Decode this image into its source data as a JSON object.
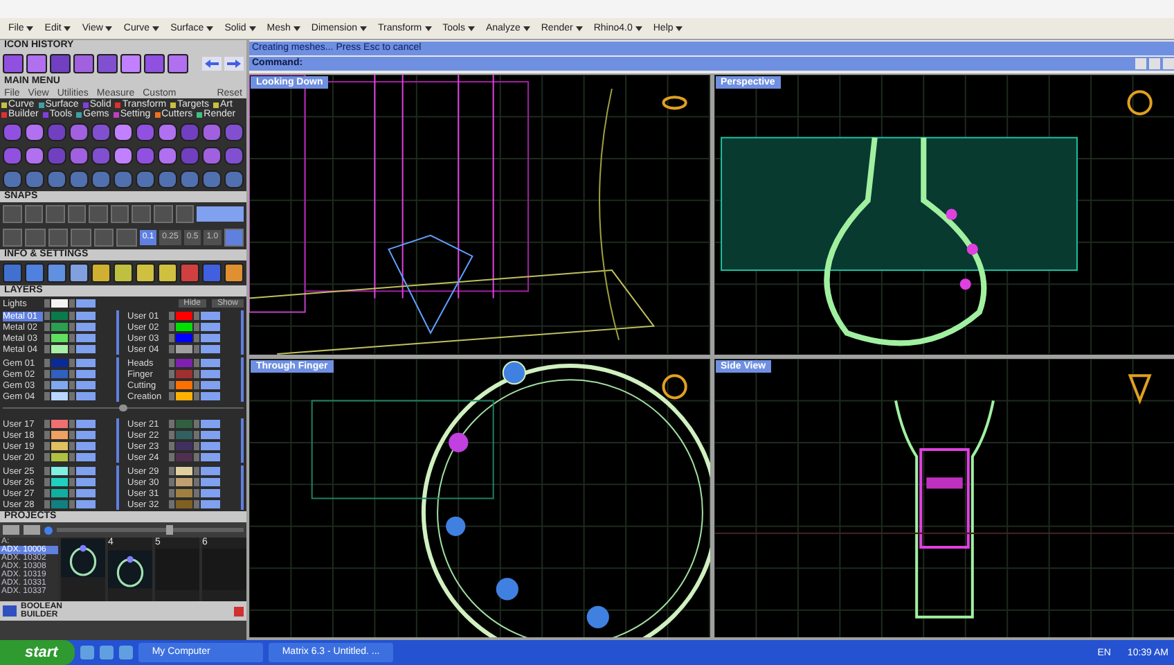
{
  "menu_bar": [
    "File",
    "Edit",
    "View",
    "Curve",
    "Surface",
    "Solid",
    "Mesh",
    "Dimension",
    "Transform",
    "Tools",
    "Analyze",
    "Render",
    "Rhino4.0",
    "Help"
  ],
  "icon_history": {
    "title": "ICON HISTORY"
  },
  "main_menu": {
    "title": "MAIN MENU",
    "menu": [
      "File",
      "View",
      "Utilities",
      "Measure",
      "Custom"
    ],
    "reset": "Reset",
    "categories": [
      {
        "label": "Curve",
        "color": "#c8c040"
      },
      {
        "label": "Surface",
        "color": "#40a0a0"
      },
      {
        "label": "Solid",
        "color": "#8040e0"
      },
      {
        "label": "Transform",
        "color": "#e03030"
      },
      {
        "label": "Targets",
        "color": "#c8c040"
      },
      {
        "label": "Art",
        "color": "#c8c040"
      },
      {
        "label": "Builder",
        "color": "#e03030"
      },
      {
        "label": "Tools",
        "color": "#8040e0"
      },
      {
        "label": "Gems",
        "color": "#40a0a0"
      },
      {
        "label": "Setting",
        "color": "#c040c0"
      },
      {
        "label": "Cutters",
        "color": "#f07020"
      },
      {
        "label": "Render",
        "color": "#40c080"
      }
    ]
  },
  "snaps": {
    "title": "SNAPS",
    "values": [
      {
        "label": "0.1",
        "selected": true
      },
      {
        "label": "0.25",
        "selected": false
      },
      {
        "label": "0.5",
        "selected": false
      },
      {
        "label": "1.0",
        "selected": false
      }
    ]
  },
  "info_settings": {
    "title": "INFO & SETTINGS"
  },
  "layers": {
    "title": "LAYERS",
    "lights": {
      "name": "Lights",
      "color": "#f4f4f4"
    },
    "hide": "Hide",
    "show": "Show",
    "sections": [
      {
        "left": [
          [
            {
              "name": "Metal 01",
              "color": "#0a7a4a",
              "selected": true
            },
            {
              "name": "Metal 02",
              "color": "#2aa050",
              "selected": false
            },
            {
              "name": "Metal 03",
              "color": "#60e060",
              "selected": false
            },
            {
              "name": "Metal 04",
              "color": "#a8f0a8",
              "selected": false
            }
          ],
          [
            {
              "name": "Gem 01",
              "color": "#0a2a9a",
              "selected": false
            },
            {
              "name": "Gem 02",
              "color": "#3060c0",
              "selected": false
            },
            {
              "name": "Gem 03",
              "color": "#80a8f0",
              "selected": false
            },
            {
              "name": "Gem 04",
              "color": "#b8d8ff",
              "selected": false
            }
          ]
        ],
        "right": [
          [
            {
              "name": "User 01",
              "color": "#ff0000",
              "selected": false
            },
            {
              "name": "User 02",
              "color": "#00e000",
              "selected": false
            },
            {
              "name": "User 03",
              "color": "#0000ff",
              "selected": false
            },
            {
              "name": "User 04",
              "color": "#a0a0a0",
              "selected": false
            }
          ],
          [
            {
              "name": "Heads",
              "color": "#8020b0",
              "selected": false
            },
            {
              "name": "Finger",
              "color": "#a03030",
              "selected": false
            },
            {
              "name": "Cutting",
              "color": "#ff7000",
              "selected": false
            },
            {
              "name": "Creation",
              "color": "#ffb000",
              "selected": false
            }
          ]
        ]
      },
      {
        "left": [
          [
            {
              "name": "User 17",
              "color": "#f07070",
              "selected": false
            },
            {
              "name": "User 18",
              "color": "#f0a060",
              "selected": false
            },
            {
              "name": "User 19",
              "color": "#e0c060",
              "selected": false
            },
            {
              "name": "User 20",
              "color": "#b0c040",
              "selected": false
            }
          ],
          [
            {
              "name": "User 25",
              "color": "#80f0e0",
              "selected": false
            },
            {
              "name": "User 26",
              "color": "#20d0c0",
              "selected": false
            },
            {
              "name": "User 27",
              "color": "#10b0a0",
              "selected": false
            },
            {
              "name": "User 28",
              "color": "#108080",
              "selected": false
            }
          ]
        ],
        "right": [
          [
            {
              "name": "User 21",
              "color": "#306040",
              "selected": false
            },
            {
              "name": "User 22",
              "color": "#306060",
              "selected": false
            },
            {
              "name": "User 23",
              "color": "#403060",
              "selected": false
            },
            {
              "name": "User 24",
              "color": "#503050",
              "selected": false
            }
          ],
          [
            {
              "name": "User 29",
              "color": "#e0d0a0",
              "selected": false
            },
            {
              "name": "User 30",
              "color": "#c0a070",
              "selected": false
            },
            {
              "name": "User 31",
              "color": "#a08040",
              "selected": false
            },
            {
              "name": "User 32",
              "color": "#806020",
              "selected": false
            }
          ]
        ]
      }
    ]
  },
  "projects": {
    "title": "PROJECTS",
    "zoom": {
      "level": 0.6
    },
    "list": [
      {
        "name": "A:",
        "selected": false
      },
      {
        "name": "ADX. 10006",
        "selected": true
      },
      {
        "name": "ADX. 10302",
        "selected": false
      },
      {
        "name": "ADX. 10308",
        "selected": false
      },
      {
        "name": "ADX. 10319",
        "selected": false
      },
      {
        "name": "ADX. 10331",
        "selected": false
      },
      {
        "name": "ADX. 10337",
        "selected": false
      }
    ],
    "thumbs": [
      {
        "kind": "ring"
      },
      {
        "number": "4",
        "kind": "ring"
      },
      {
        "number": "5",
        "kind": "empty"
      },
      {
        "number": "6",
        "kind": "empty"
      }
    ]
  },
  "boolean_builder": {
    "title": "BOOLEAN BUILDER"
  },
  "command": {
    "status": "Creating meshes... Press Esc to cancel",
    "prompt": "Command:"
  },
  "viewports": [
    {
      "label": "Looking Down",
      "kind": "top"
    },
    {
      "label": "Perspective",
      "kind": "perspective"
    },
    {
      "label": "Through Finger",
      "kind": "front"
    },
    {
      "label": "Side View",
      "kind": "side"
    }
  ],
  "taskbar": {
    "start": "start",
    "tasks": [
      {
        "label": "My Computer"
      },
      {
        "label": "Matrix 6.3 - Untitled. ..."
      }
    ],
    "language": "EN",
    "clock": "10:39 AM"
  }
}
